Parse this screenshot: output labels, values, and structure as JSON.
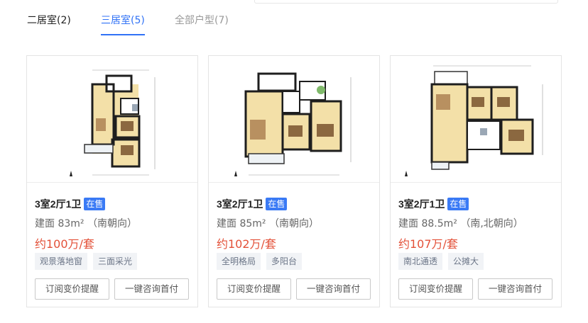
{
  "tabs": [
    {
      "label": "二居室(2)"
    },
    {
      "label": "三居室(5)"
    },
    {
      "label": "全部户型(7)"
    }
  ],
  "active_tab": 1,
  "colors": {
    "accent": "#3072f6",
    "badge": "#3a7af5",
    "price": "#e35139",
    "room_floor": "#f3e0a8",
    "wall": "#1e1e1e"
  },
  "cards": [
    {
      "layout": "3室2厅1卫",
      "status": "在售",
      "area": "建面 83m²  （南朝向）",
      "price": "约100万/套",
      "tags": [
        "观景落地窗",
        "三面采光"
      ],
      "buttons": [
        "订阅变价提醒",
        "一键咨询首付"
      ]
    },
    {
      "layout": "3室2厅1卫",
      "status": "在售",
      "area": "建面 85m²  （南朝向）",
      "price": "约102万/套",
      "tags": [
        "全明格局",
        "多阳台"
      ],
      "buttons": [
        "订阅变价提醒",
        "一键咨询首付"
      ]
    },
    {
      "layout": "3室2厅1卫",
      "status": "在售",
      "area": "建面 88.5m²  （南,北朝向）",
      "price": "约107万/套",
      "tags": [
        "南北通透",
        "公摊大"
      ],
      "buttons": [
        "订阅变价提醒",
        "一键咨询首付"
      ]
    }
  ]
}
